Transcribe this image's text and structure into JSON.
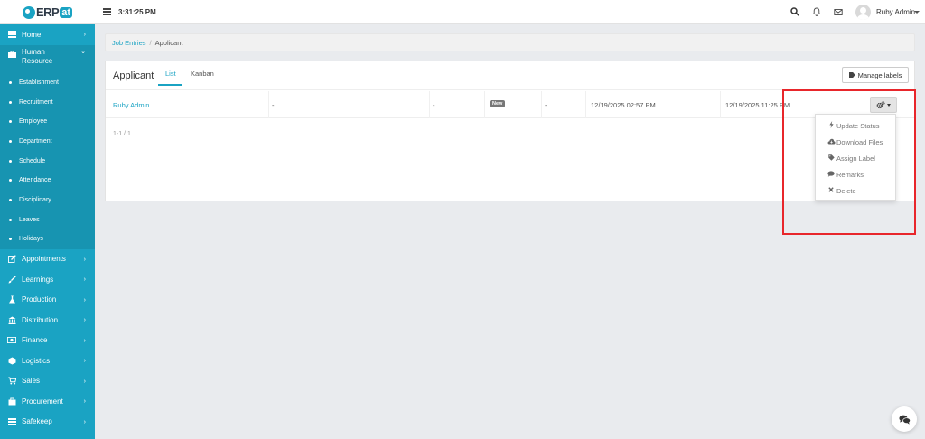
{
  "header": {
    "logo_erp": "ERP",
    "logo_at": "at",
    "clock": "3:31:25 PM",
    "user_name": "Ruby Admin"
  },
  "icons": {
    "menu": "menu-icon",
    "search": "search-icon",
    "bell": "bell-icon",
    "mail": "mail-icon",
    "chat": "chat-icon",
    "gear": "gear-icon"
  },
  "colors": {
    "accent": "#1aa3c3",
    "highlight": "#e8262b",
    "badge": "#777777"
  },
  "sidebar": {
    "items": [
      {
        "label": "Home"
      },
      {
        "label": "Human Resource"
      },
      {
        "label": "Appointments"
      },
      {
        "label": "Learnings"
      },
      {
        "label": "Production"
      },
      {
        "label": "Distribution"
      },
      {
        "label": "Finance"
      },
      {
        "label": "Logistics"
      },
      {
        "label": "Sales"
      },
      {
        "label": "Procurement"
      },
      {
        "label": "Safekeep"
      }
    ],
    "hr_submenu": [
      {
        "label": "Establishment"
      },
      {
        "label": "Recruitment"
      },
      {
        "label": "Employee"
      },
      {
        "label": "Department"
      },
      {
        "label": "Schedule"
      },
      {
        "label": "Attendance"
      },
      {
        "label": "Disciplinary"
      },
      {
        "label": "Leaves"
      },
      {
        "label": "Holidays"
      }
    ]
  },
  "breadcrumb": {
    "parent": "Job Entries",
    "separator": "/",
    "current": "Applicant"
  },
  "panel": {
    "title": "Applicant",
    "tabs": [
      {
        "label": "List",
        "active": true
      },
      {
        "label": "Kanban",
        "active": false
      }
    ],
    "manage_labels": "Manage labels"
  },
  "table": {
    "rows": [
      {
        "name": "Ruby Admin",
        "col2": "-",
        "col3": "-",
        "status": "New",
        "col5": "-",
        "created": "12/19/2025 02:57 PM",
        "updated": "12/19/2025 11:25 PM"
      }
    ],
    "pager": "1-1 / 1"
  },
  "action_menu": {
    "items": [
      {
        "label": "Update Status",
        "icon": "bolt-icon"
      },
      {
        "label": "Download Files",
        "icon": "cloud-download-icon"
      },
      {
        "label": "Assign Label",
        "icon": "tag-icon"
      },
      {
        "label": "Remarks",
        "icon": "comment-icon"
      },
      {
        "label": "Delete",
        "icon": "times-icon"
      }
    ]
  }
}
